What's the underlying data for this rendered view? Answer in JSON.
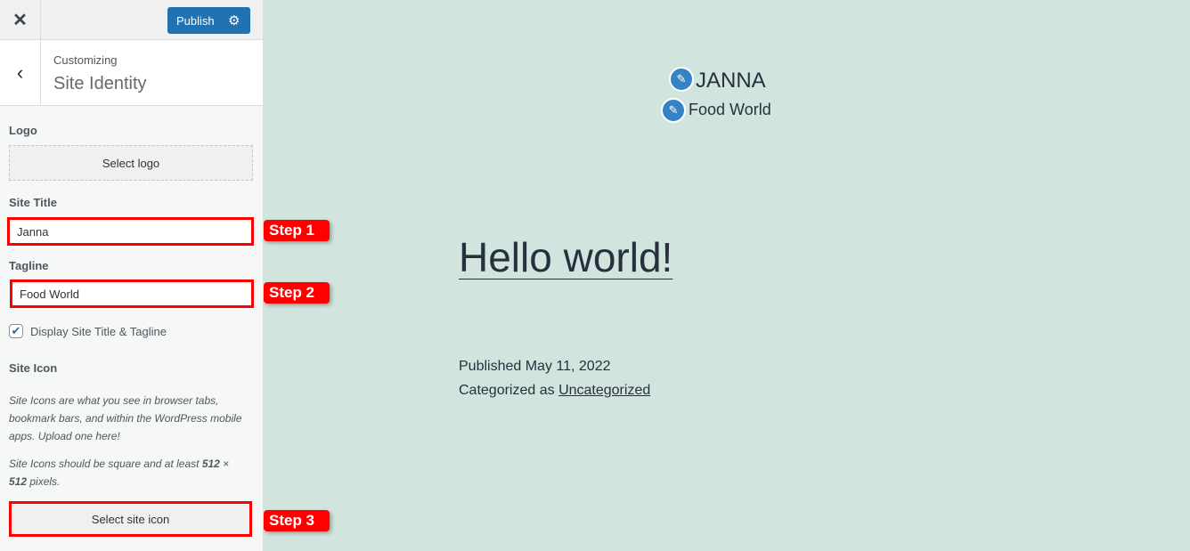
{
  "topbar": {
    "close_icon": "close-icon",
    "publish_label": "Publish",
    "settings_icon": "gear-icon"
  },
  "header": {
    "back_icon": "chevron-left-icon",
    "subtitle": "Customizing",
    "title": "Site Identity"
  },
  "panel": {
    "logo_label": "Logo",
    "select_logo": "Select logo",
    "site_title_label": "Site Title",
    "site_title_value": "Janna",
    "tagline_label": "Tagline",
    "tagline_value": "Food World",
    "display_checkbox_label": "Display Site Title & Tagline",
    "display_checked": true,
    "site_icon_label": "Site Icon",
    "site_icon_desc1": "Site Icons are what you see in browser tabs, bookmark bars, and within the WordPress mobile apps. Upload one here!",
    "site_icon_desc2_pre": "Site Icons should be square and at least ",
    "site_icon_desc2_size1": "512",
    "site_icon_desc2_x": " × ",
    "site_icon_desc2_size2": "512",
    "site_icon_desc2_post": " pixels.",
    "select_site_icon": "Select site icon"
  },
  "annotations": {
    "step1": "Step 1",
    "step2": "Step 2",
    "step3": "Step 3",
    "color": "#ff0000"
  },
  "preview": {
    "site_title": "JANNA",
    "tagline": "Food World",
    "post_title": "Hello world!",
    "published_prefix": "Published ",
    "published_date": "May 11, 2022",
    "category_prefix": "Categorized as ",
    "category": "Uncategorized",
    "background": "#d1e4dd"
  }
}
